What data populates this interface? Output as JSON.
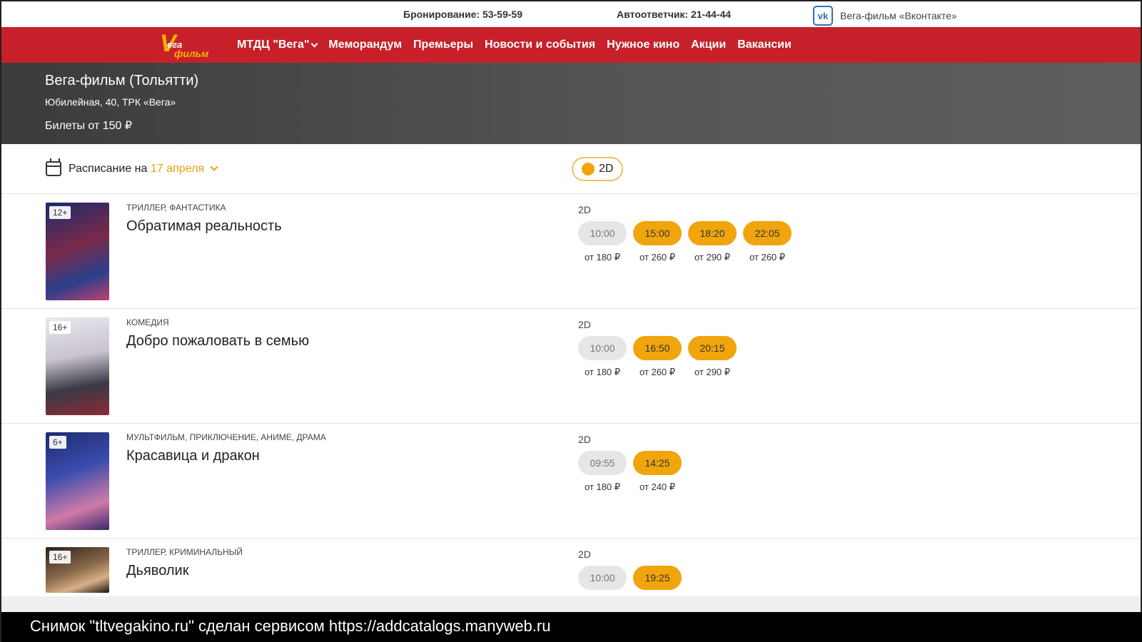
{
  "topbar": {
    "booking": "Бронирование: 53-59-59",
    "answering": "Автоответчик: 21-44-44",
    "vk_text": "Вега-фильм «Вконтакте»",
    "vk_icon": "vk-icon"
  },
  "nav": {
    "logo_v": "V",
    "logo_t1": "ега",
    "logo_t2": "фильм",
    "items": [
      {
        "label": "МТДЦ \"Вега\""
      },
      {
        "label": "Меморандум"
      },
      {
        "label": "Премьеры"
      },
      {
        "label": "Новости и события"
      },
      {
        "label": "Нужное кино"
      },
      {
        "label": "Акции"
      },
      {
        "label": "Вакансии"
      }
    ]
  },
  "hero": {
    "title": "Вега-фильм (Тольятти)",
    "address": "Юбилейная, 40, ТРК «Вега»",
    "price": "Билеты от 150 ₽"
  },
  "schedule": {
    "label": "Расписание на",
    "date": "17 апреля",
    "filter": "2D"
  },
  "colors": {
    "nav_red": "#c8202a",
    "accent_orange": "#f0a50c",
    "date_orange": "#e8a010"
  },
  "movies": [
    {
      "age": "12+",
      "genre": "ТРИЛЛЕР, ФАНТАСТИКА",
      "title": "Обратимая реальность",
      "format": "2D",
      "times": [
        {
          "time": "10:00",
          "price": "от 180 ₽",
          "state": "past"
        },
        {
          "time": "15:00",
          "price": "от 260 ₽",
          "state": "active"
        },
        {
          "time": "18:20",
          "price": "от 290 ₽",
          "state": "active"
        },
        {
          "time": "22:05",
          "price": "от 260 ₽",
          "state": "active"
        }
      ]
    },
    {
      "age": "16+",
      "genre": "КОМЕДИЯ",
      "title": "Добро пожаловать в семью",
      "format": "2D",
      "times": [
        {
          "time": "10:00",
          "price": "от 180 ₽",
          "state": "past"
        },
        {
          "time": "16:50",
          "price": "от 260 ₽",
          "state": "active"
        },
        {
          "time": "20:15",
          "price": "от 290 ₽",
          "state": "active"
        }
      ]
    },
    {
      "age": "6+",
      "genre": "МУЛЬТФИЛЬМ, ПРИКЛЮЧЕНИЕ, АНИМЕ, ДРАМА",
      "title": "Красавица и дракон",
      "format": "2D",
      "times": [
        {
          "time": "09:55",
          "price": "от 180 ₽",
          "state": "past"
        },
        {
          "time": "14:25",
          "price": "от 240 ₽",
          "state": "active"
        }
      ]
    },
    {
      "age": "16+",
      "genre": "ТРИЛЛЕР, КРИМИНАЛЬНЫЙ",
      "title": "Дьяволик",
      "format": "2D",
      "times": [
        {
          "time": "10:00",
          "price": "",
          "state": "past"
        },
        {
          "time": "19:25",
          "price": "",
          "state": "active"
        }
      ]
    }
  ],
  "caption": "Снимок \"tltvegakino.ru\" сделан сервисом https://addcatalogs.manyweb.ru"
}
